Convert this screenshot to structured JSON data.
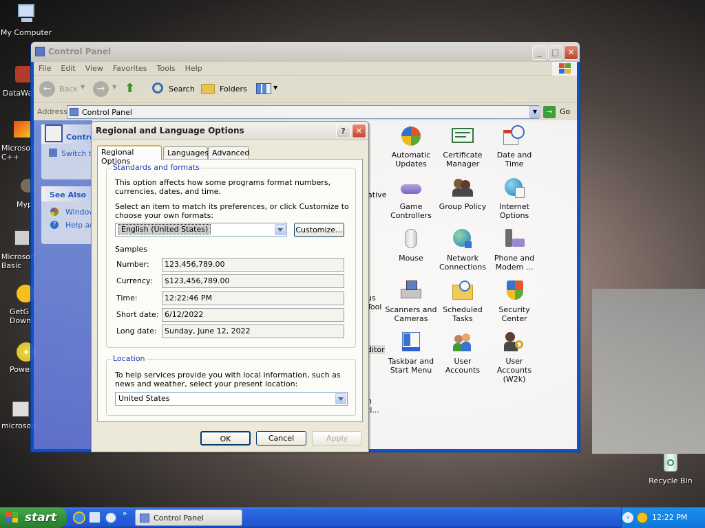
{
  "desktop": {
    "icons": [
      {
        "label": "My Computer"
      },
      {
        "label": "DataWa"
      },
      {
        "label": "Microsoft C++"
      },
      {
        "label": "Myp"
      },
      {
        "label": "Microsoft Basic"
      },
      {
        "label": "GetG Downl"
      },
      {
        "label": "Power"
      },
      {
        "label": "microsoft"
      }
    ],
    "recycle_bin": "Recycle Bin"
  },
  "control_panel": {
    "title": "Control Panel",
    "menu": [
      "File",
      "Edit",
      "View",
      "Favorites",
      "Tools",
      "Help"
    ],
    "toolbar": {
      "back": "Back",
      "search": "Search",
      "folders": "Folders"
    },
    "address_label": "Address",
    "address_value": "Control Panel",
    "go_label": "Go",
    "sidebar": {
      "panel_title": "Contro",
      "switch_link": "Switch t",
      "see_also": "See Also",
      "links": [
        "Window",
        "Help an"
      ]
    },
    "items": [
      {
        "label": "Automatic Updates"
      },
      {
        "label": "Certificate Manager"
      },
      {
        "label": "Date and Time"
      },
      {
        "label": "Game Controllers"
      },
      {
        "label": "Group Policy"
      },
      {
        "label": "Internet Options"
      },
      {
        "label": "Mouse"
      },
      {
        "label": "Network Connections"
      },
      {
        "label": "Phone and Modem ..."
      },
      {
        "label": "Scanners and Cameras"
      },
      {
        "label": "Scheduled Tasks"
      },
      {
        "label": "Security Center"
      },
      {
        "label": "Taskbar and Start Menu"
      },
      {
        "label": "User Accounts"
      },
      {
        "label": "User Accounts (W2k)"
      }
    ],
    "partial_labels": [
      "ative",
      "Tool",
      "ditor",
      "ti...",
      "us",
      "n"
    ]
  },
  "dialog": {
    "title": "Regional and Language Options",
    "help_btn": "?",
    "tabs": [
      "Regional Options",
      "Languages",
      "Advanced"
    ],
    "standards": {
      "group_label": "Standards and formats",
      "description": "This option affects how some programs format numbers, currencies, dates, and time.",
      "select_prompt": "Select an item to match its preferences, or click Customize to choose your own formats:",
      "selected_locale": "English (United States)",
      "customize_label": "Customize...",
      "samples_label": "Samples",
      "samples": [
        {
          "label": "Number:",
          "value": "123,456,789.00"
        },
        {
          "label": "Currency:",
          "value": "$123,456,789.00"
        },
        {
          "label": "Time:",
          "value": "12:22:46 PM"
        },
        {
          "label": "Short date:",
          "value": "6/12/2022"
        },
        {
          "label": "Long date:",
          "value": "Sunday, June 12, 2022"
        }
      ]
    },
    "location": {
      "group_label": "Location",
      "description": "To help services provide you with local information, such as news and weather, select your present location:",
      "selected": "United States"
    },
    "buttons": {
      "ok": "OK",
      "cancel": "Cancel",
      "apply": "Apply"
    }
  },
  "taskbar": {
    "start_label": "start",
    "task_label": "Control Panel",
    "clock": "12:22 PM"
  }
}
